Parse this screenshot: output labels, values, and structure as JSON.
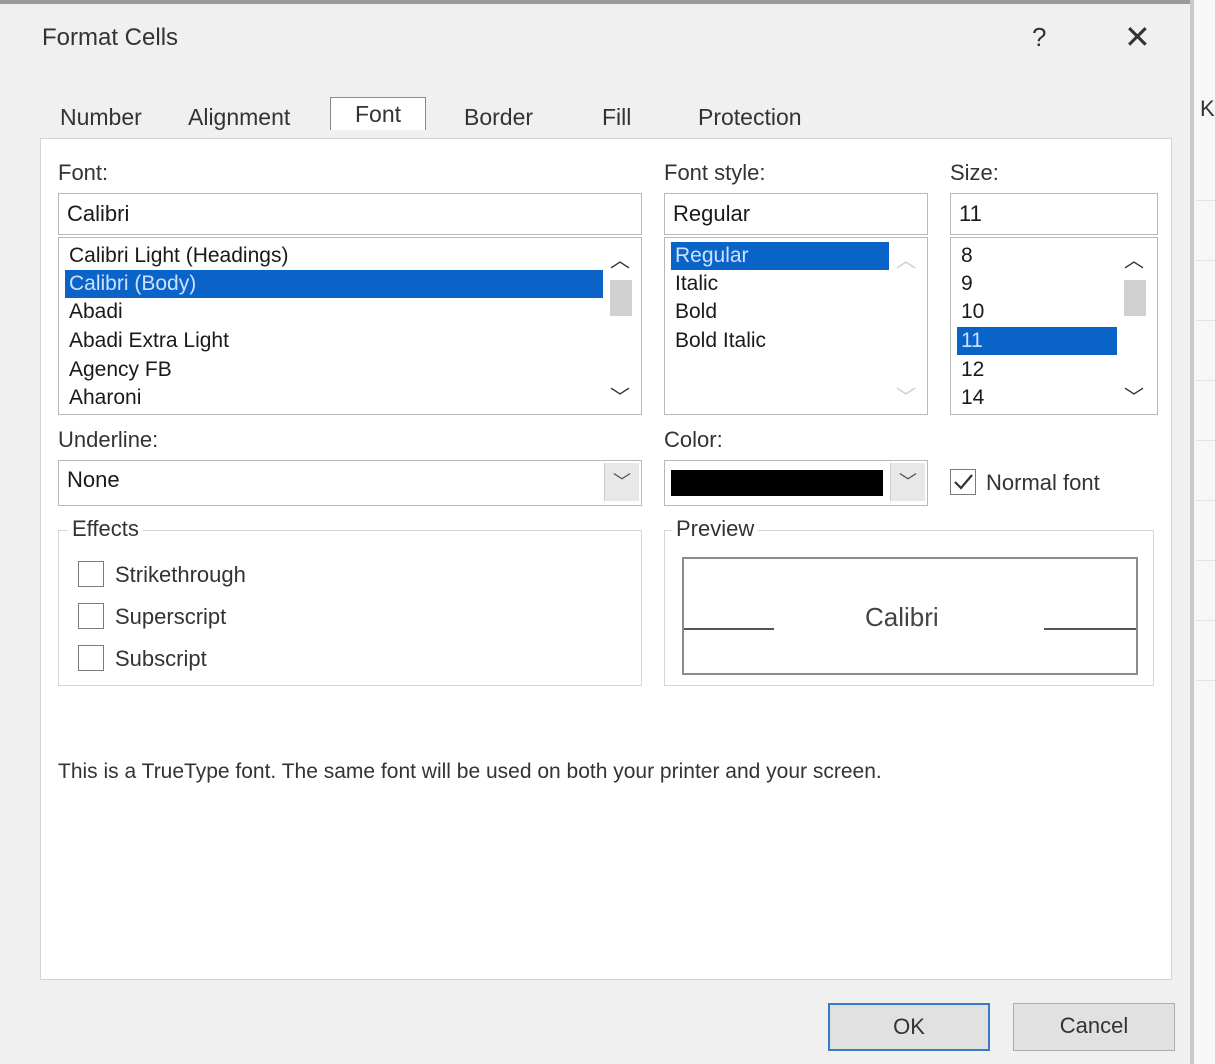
{
  "dialog": {
    "title": "Format Cells",
    "help_glyph": "?",
    "close_glyph": "✕"
  },
  "tabs": [
    {
      "label": "Number"
    },
    {
      "label": "Alignment"
    },
    {
      "label": "Font",
      "active": true
    },
    {
      "label": "Border"
    },
    {
      "label": "Fill"
    },
    {
      "label": "Protection"
    }
  ],
  "font": {
    "label": "Font:",
    "value": "Calibri",
    "items": [
      "Calibri Light (Headings)",
      "Calibri (Body)",
      "Abadi",
      "Abadi Extra Light",
      "Agency FB",
      "Aharoni"
    ],
    "selected": "Calibri (Body)"
  },
  "font_style": {
    "label": "Font style:",
    "value": "Regular",
    "items": [
      "Regular",
      "Italic",
      "Bold",
      "Bold Italic"
    ],
    "selected": "Regular"
  },
  "size": {
    "label": "Size:",
    "value": "11",
    "items": [
      "8",
      "9",
      "10",
      "11",
      "12",
      "14"
    ],
    "selected": "11"
  },
  "underline": {
    "label": "Underline:",
    "value": "None"
  },
  "color": {
    "label": "Color:",
    "swatch": "#000000",
    "normal_font_label": "Normal font",
    "normal_font_checked": true
  },
  "effects": {
    "title": "Effects",
    "items": [
      {
        "label": "Strikethrough",
        "checked": false
      },
      {
        "label": "Superscript",
        "checked": false
      },
      {
        "label": "Subscript",
        "checked": false
      }
    ]
  },
  "preview": {
    "title": "Preview",
    "sample": "Calibri"
  },
  "info_text": "This is a TrueType font.  The same font will be used on both your printer and your screen.",
  "buttons": {
    "ok": "OK",
    "cancel": "Cancel"
  },
  "background": {
    "column_letter": "K"
  },
  "colors": {
    "selection": "#0a64c8",
    "ok_border": "#3a78c8"
  }
}
